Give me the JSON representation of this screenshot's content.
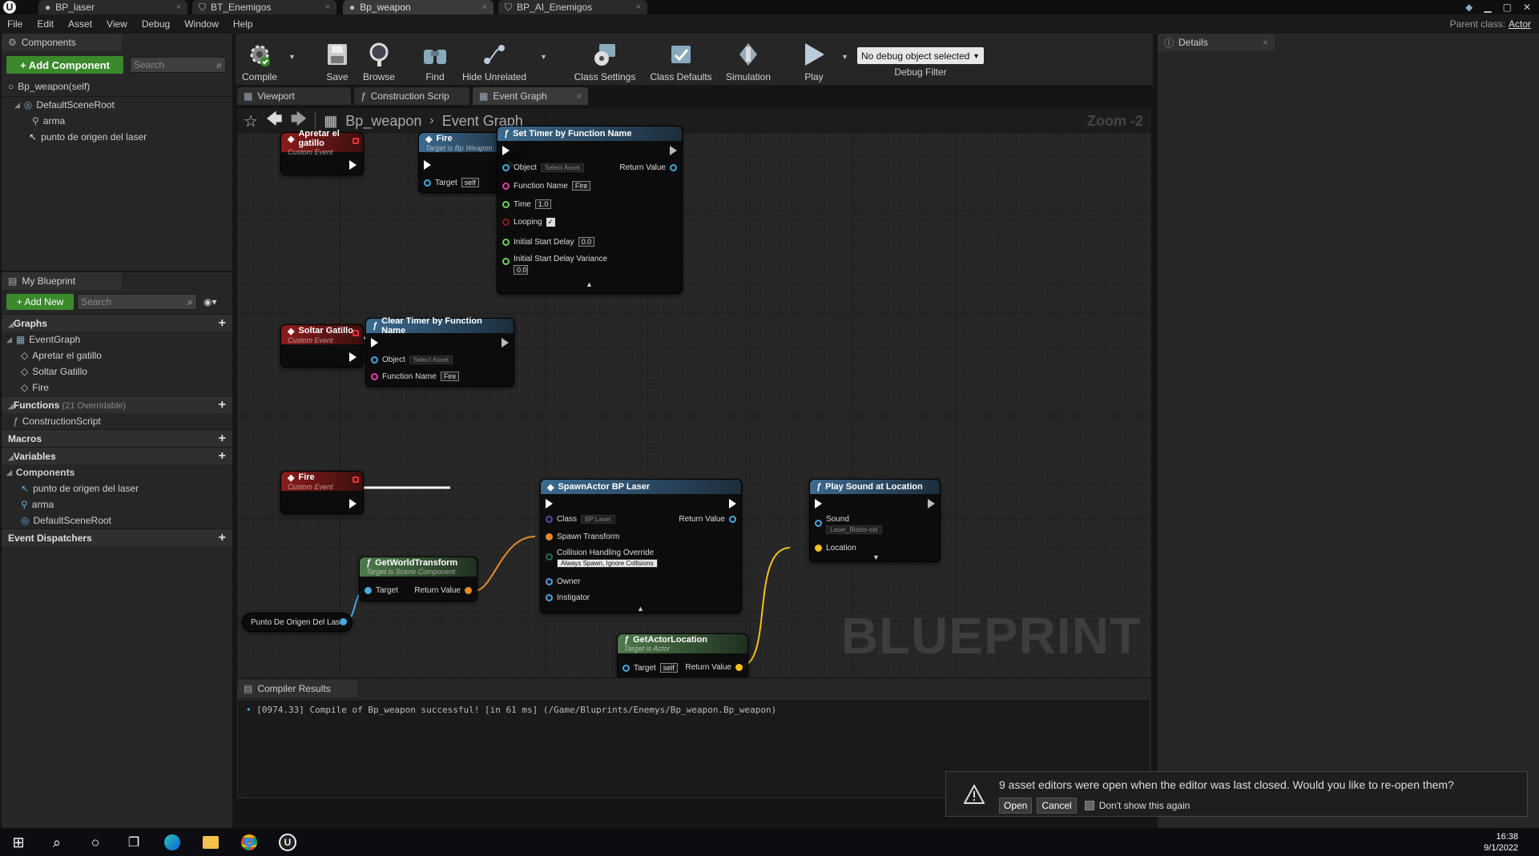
{
  "tabs": [
    {
      "label": "BP_laser",
      "active": false
    },
    {
      "label": "BT_Enemigos",
      "active": false
    },
    {
      "label": "Bp_weapon",
      "active": true
    },
    {
      "label": "BP_AI_Enemigos",
      "active": false
    }
  ],
  "parent_class": {
    "label": "Parent class:",
    "value": "Actor"
  },
  "menu": [
    "File",
    "Edit",
    "Asset",
    "View",
    "Debug",
    "Window",
    "Help"
  ],
  "components_panel": {
    "tab": "Components",
    "add_button": "+ Add Component",
    "search_placeholder": "Search",
    "self_item": "Bp_weapon(self)",
    "tree": [
      "DefaultSceneRoot",
      "arma",
      "punto de origen del laser"
    ]
  },
  "toolbar": {
    "compile": "Compile",
    "save": "Save",
    "browse": "Browse",
    "find": "Find",
    "hide_unrelated": "Hide Unrelated",
    "class_settings": "Class Settings",
    "class_defaults": "Class Defaults",
    "simulation": "Simulation",
    "play": "Play",
    "debug_object": "No debug object selected",
    "debug_filter": "Debug Filter"
  },
  "editor_tabs": [
    "Viewport",
    "Construction Scrip",
    "Event Graph"
  ],
  "breadcrumb": {
    "blueprint": "Bp_weapon",
    "graph": "Event Graph",
    "zoom": "Zoom -2"
  },
  "my_blueprint": {
    "tab": "My Blueprint",
    "add_new": "+ Add New",
    "search_placeholder": "Search",
    "graphs_label": "Graphs",
    "event_graph": "EventGraph",
    "graph_events": [
      "Apretar el gatillo",
      "Soltar Gatillo",
      "Fire"
    ],
    "functions_label": "Functions",
    "functions_count": "(21 Overridable)",
    "construction_script": "ConstructionScript",
    "macros_label": "Macros",
    "variables_label": "Variables",
    "components_label": "Components",
    "variables": [
      "punto de origen del laser",
      "arma",
      "DefaultSceneRoot"
    ],
    "dispatchers_label": "Event Dispatchers"
  },
  "details": {
    "tab": "Details"
  },
  "nodes": {
    "apretar": {
      "title": "Apretar el gatillo",
      "sub": "Custom Event"
    },
    "fire_call": {
      "title": "Fire",
      "sub": "Target is Bp Weapon",
      "target": "Target",
      "self": "self"
    },
    "set_timer": {
      "title": "Set Timer by Function Name",
      "object": "Object",
      "object_dd": "Select Asset",
      "return": "Return Value",
      "function_name": "Function Name",
      "fn_value": "Fire",
      "time": "Time",
      "time_value": "1.0",
      "looping": "Looping",
      "delay": "Initial Start Delay",
      "delay_value": "0.0",
      "variance": "Initial Start Delay Variance",
      "variance_value": "0.0"
    },
    "soltar": {
      "title": "Soltar Gatillo",
      "sub": "Custom Event"
    },
    "clear_timer": {
      "title": "Clear Timer by Function Name",
      "object": "Object",
      "object_dd": "Select Asset",
      "function_name": "Function Name",
      "fn_value": "Fire"
    },
    "fire_event": {
      "title": "Fire",
      "sub": "Custom Event"
    },
    "spawn": {
      "title": "SpawnActor BP Laser",
      "class": "Class",
      "class_dd": "BP Laser",
      "return": "Return Value",
      "spawn_transform": "Spawn Transform",
      "collision": "Collision Handling Override",
      "collision_dd": "Always Spawn, Ignore Collisions",
      "owner": "Owner",
      "instigator": "Instigator"
    },
    "play_sound": {
      "title": "Play Sound at Location",
      "sound": "Sound",
      "sound_dd": "Laser_Blasts-old",
      "location": "Location"
    },
    "get_world": {
      "title": "GetWorldTransform",
      "sub": "Target is Scene Component",
      "target": "Target",
      "return": "Return Value"
    },
    "get_actor": {
      "title": "GetActorLocation",
      "sub": "Target is Actor",
      "target": "Target",
      "self": "self",
      "return": "Return Value"
    },
    "punto": {
      "title": "Punto De Origen Del Laser"
    }
  },
  "watermark": "BLUEPRINT",
  "compiler": {
    "tab": "Compiler Results",
    "message": "[0974.33] Compile of Bp_weapon successful! [in 61 ms] (/Game/Bluprints/Enemys/Bp_weapon.Bp_weapon)"
  },
  "notification": {
    "text": "9 asset editors were open when the editor was last closed. Would you like to re-open them?",
    "open": "Open",
    "cancel": "Cancel",
    "dont_show": "Don't show this again"
  },
  "clock": {
    "time": "16:38",
    "date": "9/1/2022"
  },
  "colors": {
    "green_button": "#3a8a2c",
    "event_header": "#8c1b1b",
    "function_header": "#3c6a8f",
    "pure_header": "#4e7a4b"
  }
}
